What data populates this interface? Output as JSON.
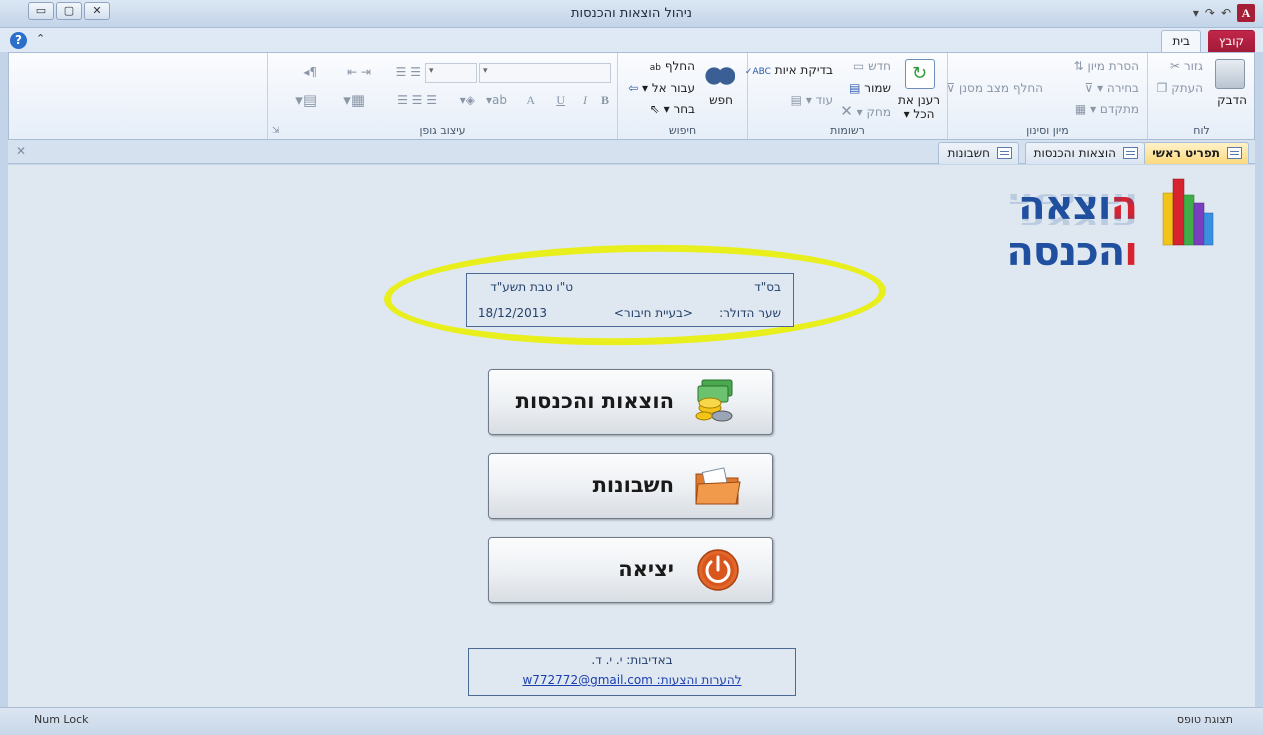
{
  "window": {
    "title": "ניהול הוצאות והכנסות",
    "minimize": "▭",
    "restore": "▢",
    "close": "✕"
  },
  "qat": {
    "undo": "↶",
    "redo": "↷",
    "customize": "▾",
    "app_letter": "A"
  },
  "tabs": {
    "file": "קובץ",
    "home": "בית"
  },
  "ribbon": {
    "clipboard": {
      "label": "לוח",
      "paste": "הדבק",
      "cut": "גזור",
      "copy": "העתק"
    },
    "sort_filter": {
      "label": "מיון וסינון",
      "remove_sort": "הסרת מיון",
      "selection": "בחירה ▾",
      "advanced": "מתקדם ▾",
      "toggle_filter": "החלף מצב מסנן"
    },
    "records": {
      "label": "רשומות",
      "refresh": "רענן את הכל ▾",
      "new": "חדש",
      "save": "שמור",
      "delete": "מחק ▾",
      "spelling": "בדיקת איות",
      "more": "עוד ▾"
    },
    "find": {
      "label": "חיפוש",
      "find": "חפש",
      "replace": "החלף",
      "goto": "עבור אל ▾",
      "select": "בחר ▾"
    },
    "text_format": {
      "label": "עיצוב גופן",
      "bold": "B",
      "italic": "I",
      "underline": "U",
      "font_color": "A"
    }
  },
  "doc_tabs": [
    "תפריט ראשי",
    "הוצאות והכנסות",
    "חשבונות"
  ],
  "logo": {
    "text_red": "ה",
    "text_blue_1": "וצאה ",
    "text_blue_2": "הכנסה",
    "text_red_2": "ו"
  },
  "info": {
    "bsd": "בס\"ד",
    "hebrew_date": "ט\"ו טבת תשע\"ד",
    "dollar_label": "שער הדולר:",
    "dollar_value": "<בעיית חיבור>",
    "date": "18/12/2013"
  },
  "buttons": {
    "expenses": "הוצאות והכנסות",
    "accounts": "חשבונות",
    "exit": "יציאה"
  },
  "footer": {
    "credit": "באדיבות: י. י. ד.",
    "contact": "להערות והצעות: w772772@gmail.com"
  },
  "status": {
    "left": "Num Lock",
    "right": "תצוגת טופס"
  },
  "colors": {
    "highlight": "#e8ef1c",
    "file_tab": "#a11a38",
    "form_bg": "#dfe7f0"
  }
}
